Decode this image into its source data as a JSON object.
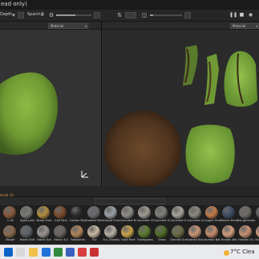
{
  "window": {
    "title_fragment": "ead only)"
  },
  "toolbar": {
    "label_left": "Depth",
    "spacing_label": "Spacing",
    "spacing_value": "1"
  },
  "viewport_2d": {
    "channel_select": "Material"
  },
  "viewport_3d": {
    "channel_select": "Material"
  },
  "shelf": {
    "tab_label": "terial (1)",
    "row1": [
      {
        "label": "n all",
        "color": "#8a5a3c"
      },
      {
        "label": "Aged pain",
        "color": "#7a7a74"
      },
      {
        "label": "Brass Pure",
        "color": "#b18c3e"
      },
      {
        "label": "Calf Skin",
        "color": "#7c4b2b"
      },
      {
        "label": "Carbon Fibe",
        "color": "#2b2b2b"
      },
      {
        "label": "Coated Meta",
        "color": "#6b6b70"
      },
      {
        "label": "Cobalt Pure",
        "color": "#9aa0a8"
      },
      {
        "label": "Concrete B.",
        "color": "#8f8c86"
      },
      {
        "label": "Concrete Cl",
        "color": "#9e9a92"
      },
      {
        "label": "Concrete D.",
        "color": "#7f7d78"
      },
      {
        "label": "Concrete S.",
        "color": "#a7a39a"
      },
      {
        "label": "Concrete S.",
        "color": "#8b8880"
      },
      {
        "label": "Copper Pure",
        "color": "#c07a4a"
      },
      {
        "label": "Denim Rivet",
        "color": "#3d4c63"
      },
      {
        "label": "Est.generate",
        "color": "#6e6a64"
      },
      {
        "label": "Fabri",
        "color": "#5a5a5a"
      }
    ],
    "row2": [
      {
        "label": "Rough",
        "color": "#8a6a4c"
      },
      {
        "label": "Fabric Knit",
        "color": "#5c5f66"
      },
      {
        "label": "Fabric Sof",
        "color": "#9a9490"
      },
      {
        "label": "Fabric Sui",
        "color": "#6a6460"
      },
      {
        "label": "Footprints",
        "color": "#b0855a"
      },
      {
        "label": "Fur",
        "color": "#c7b8a2"
      },
      {
        "label": "Fur_Ghostly",
        "color": "#b8b0a5"
      },
      {
        "label": "Gold Pure",
        "color": "#c9a24a"
      },
      {
        "label": "Grassgrass",
        "color": "#5d7a2c"
      },
      {
        "label": "Grass",
        "color": "#4e6b26"
      },
      {
        "label": "Ground Gra.",
        "color": "#6b6a45"
      },
      {
        "label": "Human Bac.",
        "color": "#c99576"
      },
      {
        "label": "Human Bel.",
        "color": "#c48c6d"
      },
      {
        "label": "Human Bel.",
        "color": "#d19c7d"
      },
      {
        "label": "Human Ch.",
        "color": "#c69070"
      },
      {
        "label": "Human Fa.",
        "color": "#cf9a78"
      }
    ]
  },
  "taskbar": {
    "weather": "7°C  Clea"
  },
  "colors": {
    "grass": "#7aa83a",
    "bark": "#5a3a22",
    "orange_tab": "#e39a3d"
  }
}
